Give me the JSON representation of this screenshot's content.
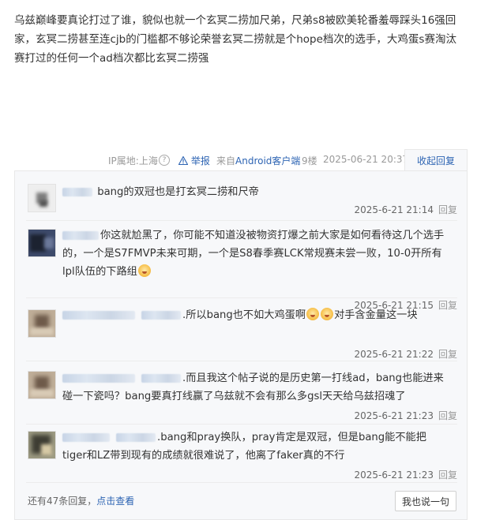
{
  "post": {
    "content": "乌兹巅峰要真论打过了谁，貌似也就一个玄冥二捞加尺弟，尺弟s8被欧美轮番羞辱踩头16强回家，玄冥二捞甚至连cjb的门槛都不够论荣誉玄冥二捞就是个hope档次的选手，大鸡蛋s赛淘汰赛打过的任何一个ad档次都比玄冥二捞强"
  },
  "meta": {
    "ip_label": "IP属地:上海",
    "help_icon": "?",
    "report_label": "举报",
    "from_prefix": "来自",
    "client": "Android客户端",
    "floor": "9楼",
    "time": "2025-06-21 20:37",
    "collapse_label": "收起回复"
  },
  "replies": [
    {
      "text": "bang的双冠也是打玄冥二捞和尺帝",
      "time": "2025-6-21 21:14",
      "reply_label": "回复"
    },
    {
      "text_a": "你这就尬黑了，你可能不知道没被物资打爆之前大家是如何看待这几个选手的，一个是S7FMVP未来可期，一个是S8春季赛LCK常规赛未尝一败，10-0开所有lpl队伍的下路组",
      "time": "2025-6-21 21:15",
      "reply_label": "回复"
    },
    {
      "text_a": ".所以bang也不如大鸡蛋啊",
      "text_b": "对手含金量这一块",
      "time": "2025-6-21 21:22",
      "reply_label": "回复"
    },
    {
      "text_a": ".而且我这个帖子说的是历史第一打线ad，bang也能进来碰一下瓷吗？bang要真打线赢了乌兹就不会有那么多gsl天天给乌兹招魂了",
      "time": "2025-6-21 21:23",
      "reply_label": "回复"
    },
    {
      "text_a": ".bang和pray换队，pray肯定是双冠，但是bang能不能把tiger和LZ带到现有的成绩就很难说了，他离了faker真的不行",
      "time": "2025-6-21 21:23",
      "reply_label": "回复"
    }
  ],
  "footer": {
    "more_prefix": "还有47条回复，",
    "more_link": "点击查看",
    "say_button": "我也说一句"
  },
  "colors": {
    "link": "#2d64b3",
    "box_bg": "#f7f8fa",
    "border": "#e8e8e8"
  }
}
